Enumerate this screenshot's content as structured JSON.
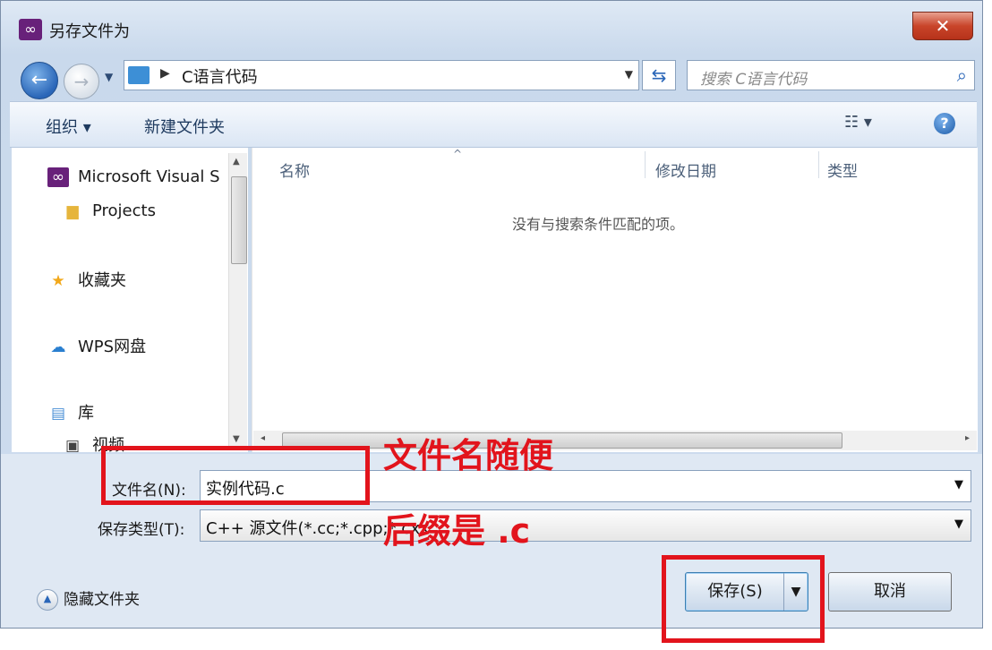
{
  "window": {
    "title": "另存文件为",
    "close_label": "✕"
  },
  "nav": {
    "address": "C语言代码",
    "search_placeholder": "搜索 C语言代码"
  },
  "toolbar": {
    "organize": "组织 ▾",
    "new_folder": "新建文件夹"
  },
  "sidebar": {
    "items": [
      {
        "label": "Microsoft Visual S",
        "icon": "visual-studio-icon"
      },
      {
        "label": "Projects",
        "icon": "folder-icon"
      },
      {
        "label": "收藏夹",
        "icon": "star-icon"
      },
      {
        "label": "WPS网盘",
        "icon": "cloud-icon"
      },
      {
        "label": "库",
        "icon": "library-icon"
      },
      {
        "label": "视频",
        "icon": "video-icon"
      }
    ]
  },
  "content": {
    "columns": [
      "名称",
      "修改日期",
      "类型"
    ],
    "empty_message": "没有与搜索条件匹配的项。"
  },
  "form": {
    "filename_label": "文件名(N):",
    "filename_value": "实例代码.c",
    "filetype_label": "保存类型(T):",
    "filetype_value": "C++ 源文件(*.cc;*.cpp;*.cxx"
  },
  "footer": {
    "hide_folders": "隐藏文件夹",
    "save_label": "保存(S)",
    "cancel_label": "取消"
  },
  "annotations": {
    "line1": "文件名随便",
    "line2": "后缀是 .c",
    "color": "#e2141c"
  }
}
